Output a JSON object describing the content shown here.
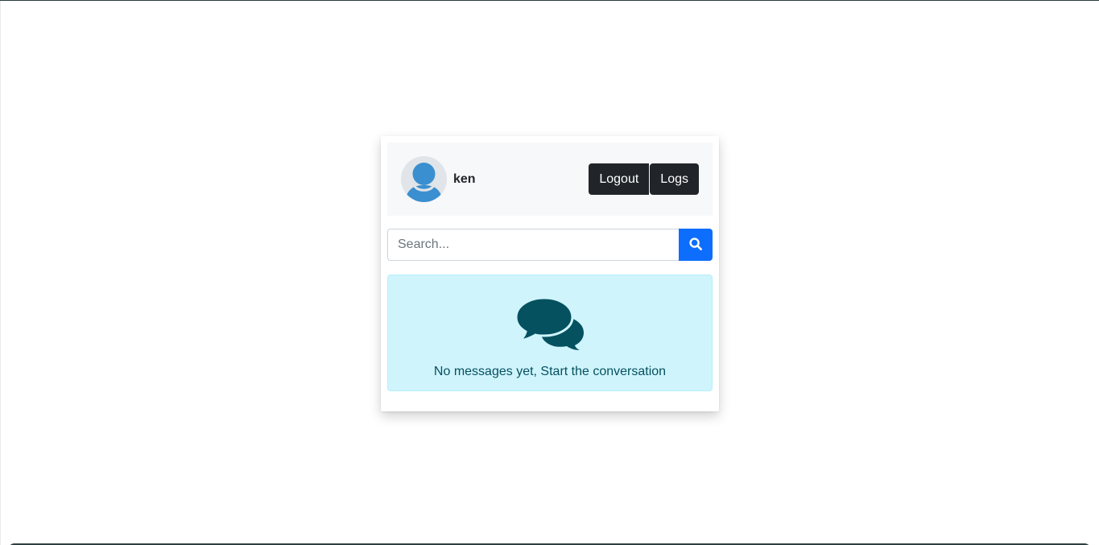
{
  "user": {
    "name": "ken",
    "avatar_icon": "user-avatar-icon"
  },
  "header": {
    "logout_label": "Logout",
    "logs_label": "Logs"
  },
  "search": {
    "placeholder": "Search...",
    "value": "",
    "button_icon": "search-icon"
  },
  "empty_state": {
    "icon": "chat-bubbles-icon",
    "message": "No messages yet, Start the conversation"
  },
  "colors": {
    "primary": "#0d6efd",
    "dark": "#212529",
    "info_bg": "#cff4fc",
    "info_text": "#055160",
    "avatar_blue": "#3a8fd0"
  }
}
